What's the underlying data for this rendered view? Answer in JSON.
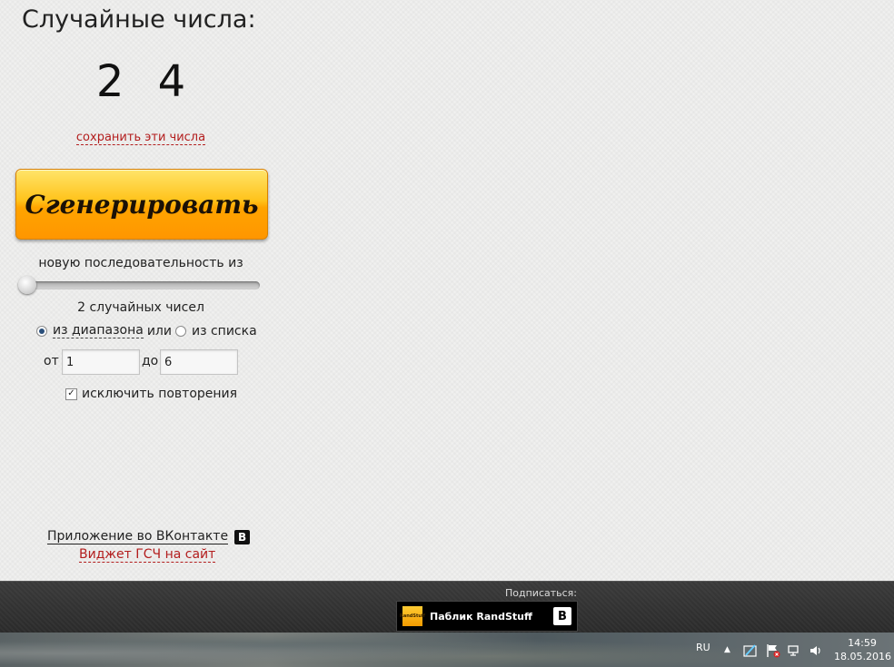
{
  "main": {
    "title": "Случайные числа:",
    "numbers": "2 4",
    "save_link": "сохранить эти числа",
    "generate_button": "Сгенерировать",
    "sequence_label": "новую последовательность из",
    "slider_value": 2,
    "count_label": "2 случайных чисел",
    "mode": {
      "range_option": "из диапазона",
      "or_text": "или",
      "list_option": "из списка",
      "selected": "range"
    },
    "range": {
      "from_label": "от",
      "from_value": "1",
      "to_label": "до",
      "to_value": "6"
    },
    "exclude_repeats": {
      "label": "исключить повторения",
      "checked": true
    },
    "vk_app_link": "Приложение во ВКонтакте",
    "vk_icon": "В",
    "widget_link": "Виджет ГСЧ на сайт"
  },
  "footer": {
    "subscribe_label": "Подписаться:",
    "public_logo_text": "RandStuff",
    "public_name": "Паблик RandStuff",
    "public_vk_icon": "В"
  },
  "taskbar": {
    "language": "RU",
    "time": "14:59",
    "date": "18.05.2016"
  },
  "colors": {
    "button_orange": "#ffa400",
    "link_red": "#b31d1d",
    "footer_dark": "#2a2a2a"
  }
}
